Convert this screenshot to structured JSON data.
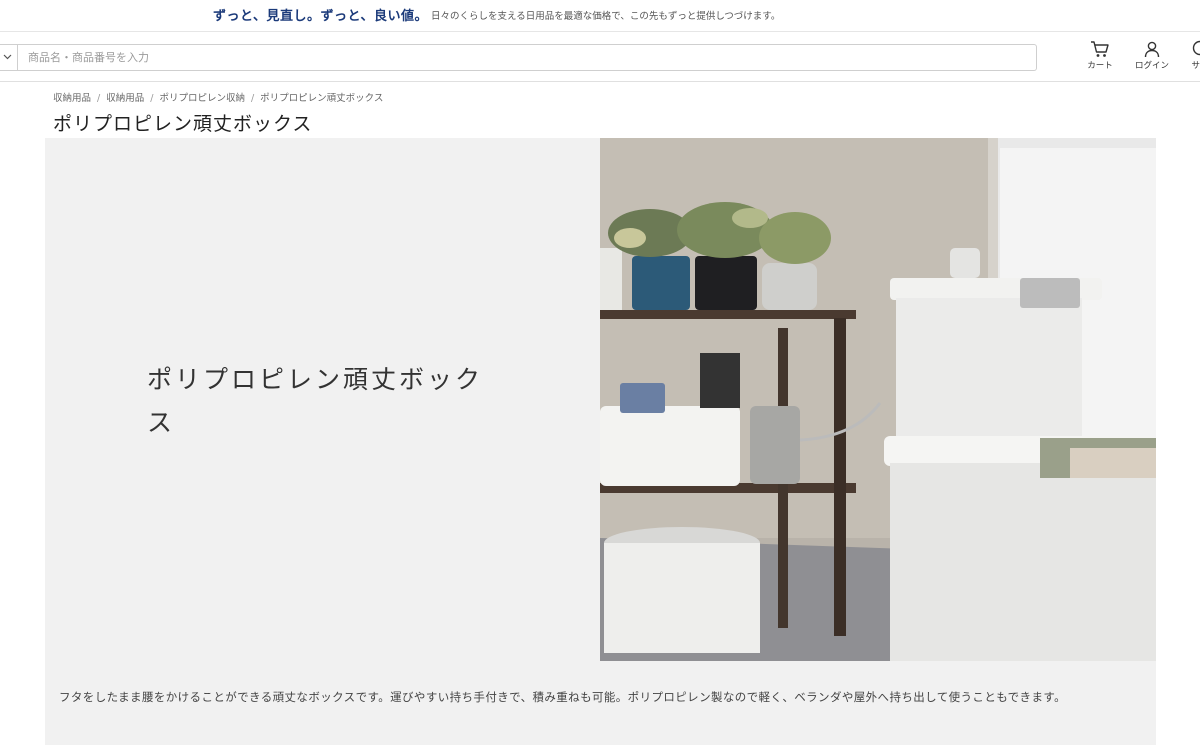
{
  "banner": {
    "slogan": "ずっと、見直し。ずっと、良い値。",
    "subtext": "日々のくらしを支える日用品を最適な価格で、この先もずっと提供しつづけます。"
  },
  "header": {
    "search_placeholder": "商品名・商品番号を入力",
    "cart_label": "カート",
    "login_label": "ログイン",
    "support_label": "サポ"
  },
  "breadcrumb": [
    "収納用品",
    "収納用品",
    "ポリプロピレン収納",
    "ポリプロピレン頑丈ボックス"
  ],
  "page": {
    "title": "ポリプロピレン頑丈ボックス"
  },
  "hero": {
    "heading": "ポリプロピレン頑丈ボックス",
    "description": "フタをしたまま腰をかけることができる頑丈なボックスです。運びやすい持ち手付きで、積み重ねも可能。ポリプロピレン製なので軽く、ベランダや屋外へ持ち出して使うこともできます。"
  },
  "colors": {
    "brand": "#1b3a7a",
    "hero_bg": "#f1f1f1"
  },
  "icons": [
    "chevron-down-icon",
    "cart-icon",
    "user-icon",
    "support-icon"
  ]
}
